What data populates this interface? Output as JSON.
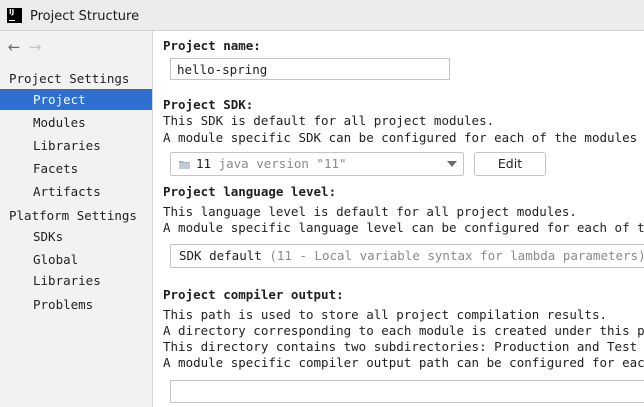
{
  "window": {
    "title": "Project Structure",
    "logo_text": "IJ"
  },
  "nav": {
    "back_icon": "arrow-left-icon",
    "forward_icon": "arrow-right-icon",
    "back_glyph": "←",
    "forward_glyph": "→"
  },
  "sidebar": {
    "project_settings_heading": "Project Settings",
    "project_items": [
      "Project",
      "Modules",
      "Libraries",
      "Facets",
      "Artifacts"
    ],
    "platform_settings_heading": "Platform Settings",
    "platform_items": [
      "SDKs",
      "Global Libraries"
    ],
    "other_items": [
      "Problems"
    ],
    "selected": "Project"
  },
  "main": {
    "project_name": {
      "label": "Project name:",
      "value": "hello-spring"
    },
    "project_sdk": {
      "label": "Project SDK:",
      "desc_lines": [
        "This SDK is default for all project modules.",
        "A module specific SDK can be configured for each of the modules as re"
      ],
      "selected_version": "11",
      "selected_detail": "java version \"11\"",
      "edit_label": "Edit"
    },
    "language_level": {
      "label": "Project language level:",
      "desc_lines": [
        "This language level is default for all project modules.",
        "A module specific language level can be configured for each of the mo"
      ],
      "selected_value": "SDK default",
      "selected_detail": "(11 - Local variable syntax for lambda parameters)"
    },
    "compiler_output": {
      "label": "Project compiler output:",
      "desc_lines": [
        "This path is used to store all project compilation results.",
        "A directory corresponding to each module is created under this path.",
        "This directory contains two subdirectories: Production and Test for p",
        "A module specific compiler output path can be configured for each of"
      ],
      "value": ""
    }
  },
  "colors": {
    "selection": "#2f6fd0",
    "sidebar_bg": "#f2f2f2"
  }
}
